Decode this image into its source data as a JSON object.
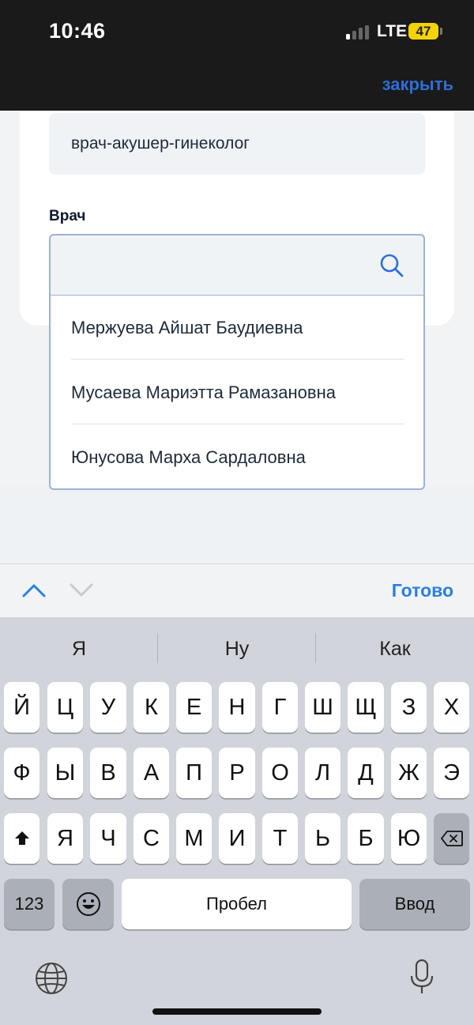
{
  "status": {
    "time": "10:46",
    "network": "LTE",
    "battery": "47"
  },
  "header": {
    "close": "закрыть"
  },
  "form": {
    "specialty": "врач-акушер-гинеколог",
    "doctor_label": "Врач",
    "search_value": "",
    "options": [
      "Мержуева Айшат Баудиевна",
      "Мусаева Мариэтта Рамазановна",
      "Юнусова Марха Сардаловна"
    ]
  },
  "accessory": {
    "done": "Готово"
  },
  "keyboard": {
    "suggestions": [
      "Я",
      "Ну",
      "Как"
    ],
    "row1": [
      "Й",
      "Ц",
      "У",
      "К",
      "Е",
      "Н",
      "Г",
      "Ш",
      "Щ",
      "З",
      "Х"
    ],
    "row2": [
      "Ф",
      "Ы",
      "В",
      "А",
      "П",
      "Р",
      "О",
      "Л",
      "Д",
      "Ж",
      "Э"
    ],
    "row3": [
      "Я",
      "Ч",
      "С",
      "М",
      "И",
      "Т",
      "Ь",
      "Б",
      "Ю"
    ],
    "numbers": "123",
    "space": "Пробел",
    "return": "Ввод"
  },
  "colors": {
    "accent": "#2f6ed8",
    "done": "#2c7fdc",
    "battery": "#f5d300"
  }
}
